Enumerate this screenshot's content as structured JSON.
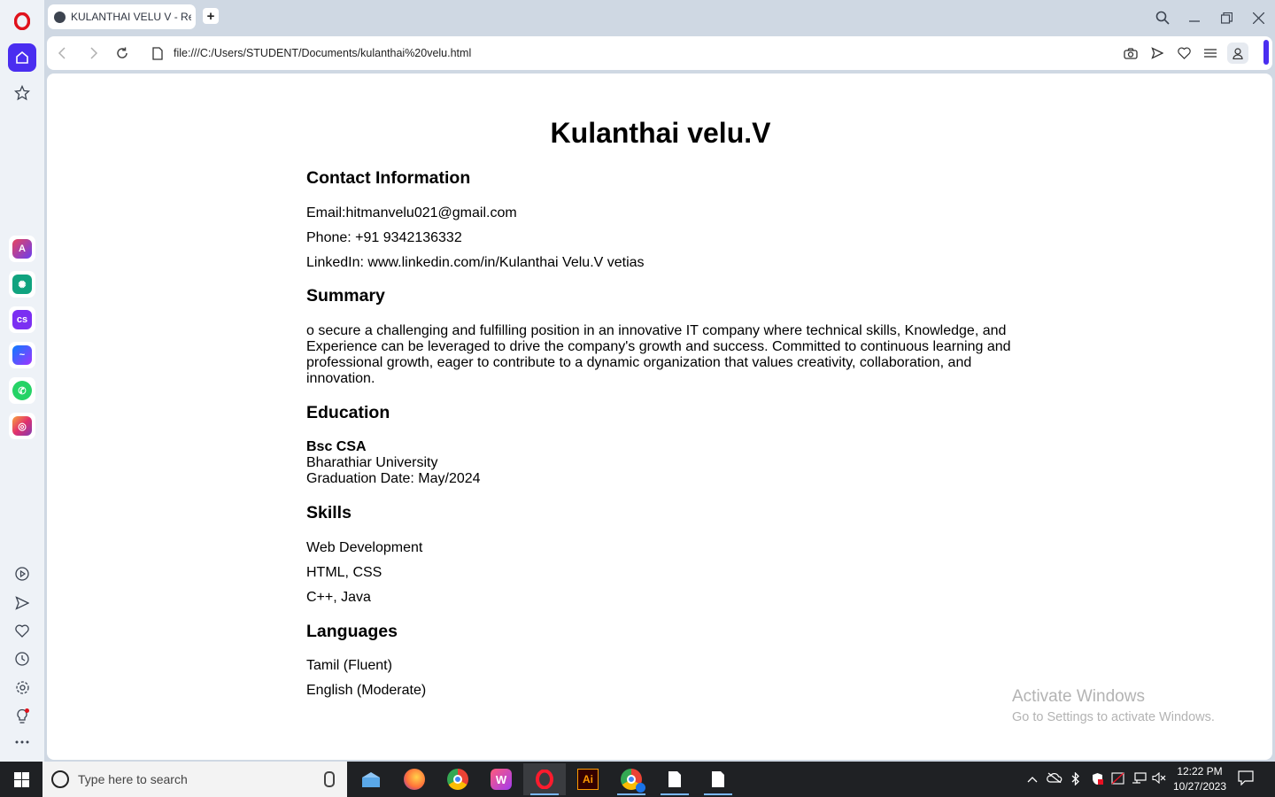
{
  "browser": {
    "tab_title": "KULANTHAI VELU V - Res",
    "new_tab_symbol": "+",
    "url": "file:///C:/Users/STUDENT/Documents/kulanthai%20velu.html",
    "accent_color": "#4a2ef0"
  },
  "sidebar": {
    "top_icons": [
      "opera-logo-icon",
      "home-icon",
      "star-icon"
    ],
    "apps": [
      "aria-icon",
      "chatgpt-icon",
      "chatsonic-icon",
      "messenger-icon",
      "whatsapp-icon",
      "instagram-icon"
    ],
    "bottom_icons": [
      "player-icon",
      "send-icon",
      "heart-icon",
      "history-icon",
      "settings-icon",
      "tips-icon",
      "more-icon"
    ]
  },
  "resume": {
    "name": "Kulanthai velu.V",
    "contact": {
      "heading": "Contact Information",
      "email": "Email:hitmanvelu021@gmail.com",
      "phone": "Phone: +91 9342136332",
      "linkedin": "LinkedIn: www.linkedin.com/in/Kulanthai Velu.V vetias"
    },
    "summary": {
      "heading": "Summary",
      "text": "o secure a challenging and fulfilling position in an innovative IT company where technical skills, Knowledge, and Experience can be leveraged to drive the company's growth and success. Committed to continuous learning and professional growth, eager to contribute to a dynamic organization that values creativity, collaboration, and innovation."
    },
    "education": {
      "heading": "Education",
      "degree": "Bsc CSA",
      "university": "Bharathiar University",
      "graduation": "Graduation Date: May/2024"
    },
    "skills": {
      "heading": "Skills",
      "items": [
        "Web Development",
        "HTML, CSS",
        "C++, Java"
      ]
    },
    "languages": {
      "heading": "Languages",
      "items": [
        "Tamil (Fluent)",
        "English (Moderate)"
      ]
    }
  },
  "watermark": {
    "title": "Activate Windows",
    "subtitle": "Go to Settings to activate Windows."
  },
  "taskbar": {
    "search_placeholder": "Type here to search",
    "apps": [
      "file-explorer-icon",
      "firefox-icon",
      "chrome-icon",
      "wps-office-icon",
      "opera-icon",
      "illustrator-icon",
      "chrome-profile-icon",
      "document-icon",
      "document-icon"
    ],
    "time": "12:22 PM",
    "date": "10/27/2023"
  }
}
